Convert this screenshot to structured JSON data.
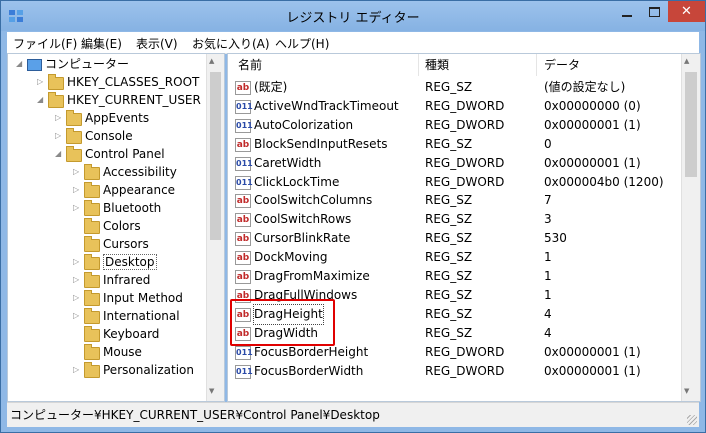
{
  "window": {
    "title": "レジストリ エディター"
  },
  "menu": [
    "ファイル(F)",
    "編集(E)",
    "表示(V)",
    "お気に入り(A)",
    "ヘルプ(H)"
  ],
  "tree": {
    "root": "コンピューター",
    "items": [
      {
        "label": "HKEY_CLASSES_ROOT",
        "level": 1,
        "arrow": "▷"
      },
      {
        "label": "HKEY_CURRENT_USER",
        "level": 1,
        "arrow": "◢"
      },
      {
        "label": "AppEvents",
        "level": 2,
        "arrow": "▷"
      },
      {
        "label": "Console",
        "level": 2,
        "arrow": "▷"
      },
      {
        "label": "Control Panel",
        "level": 2,
        "arrow": "◢"
      },
      {
        "label": "Accessibility",
        "level": 3,
        "arrow": "▷"
      },
      {
        "label": "Appearance",
        "level": 3,
        "arrow": "▷"
      },
      {
        "label": "Bluetooth",
        "level": 3,
        "arrow": "▷"
      },
      {
        "label": "Colors",
        "level": 3,
        "arrow": ""
      },
      {
        "label": "Cursors",
        "level": 3,
        "arrow": ""
      },
      {
        "label": "Desktop",
        "level": 3,
        "arrow": "▷",
        "selected": true
      },
      {
        "label": "Infrared",
        "level": 3,
        "arrow": "▷"
      },
      {
        "label": "Input Method",
        "level": 3,
        "arrow": "▷"
      },
      {
        "label": "International",
        "level": 3,
        "arrow": "▷"
      },
      {
        "label": "Keyboard",
        "level": 3,
        "arrow": ""
      },
      {
        "label": "Mouse",
        "level": 3,
        "arrow": ""
      },
      {
        "label": "Personalization",
        "level": 3,
        "arrow": "▷"
      }
    ]
  },
  "list": {
    "headers": {
      "name": "名前",
      "type": "種類",
      "data": "データ"
    },
    "rows": [
      {
        "icon": "ab",
        "name": "(既定)",
        "type": "REG_SZ",
        "data": "(値の設定なし)"
      },
      {
        "icon": "num",
        "name": "ActiveWndTrackTimeout",
        "type": "REG_DWORD",
        "data": "0x00000000 (0)"
      },
      {
        "icon": "num",
        "name": "AutoColorization",
        "type": "REG_DWORD",
        "data": "0x00000001 (1)"
      },
      {
        "icon": "ab",
        "name": "BlockSendInputResets",
        "type": "REG_SZ",
        "data": "0"
      },
      {
        "icon": "num",
        "name": "CaretWidth",
        "type": "REG_DWORD",
        "data": "0x00000001 (1)"
      },
      {
        "icon": "num",
        "name": "ClickLockTime",
        "type": "REG_DWORD",
        "data": "0x000004b0 (1200)"
      },
      {
        "icon": "ab",
        "name": "CoolSwitchColumns",
        "type": "REG_SZ",
        "data": "7"
      },
      {
        "icon": "ab",
        "name": "CoolSwitchRows",
        "type": "REG_SZ",
        "data": "3"
      },
      {
        "icon": "ab",
        "name": "CursorBlinkRate",
        "type": "REG_SZ",
        "data": "530"
      },
      {
        "icon": "ab",
        "name": "DockMoving",
        "type": "REG_SZ",
        "data": "1"
      },
      {
        "icon": "ab",
        "name": "DragFromMaximize",
        "type": "REG_SZ",
        "data": "1"
      },
      {
        "icon": "ab",
        "name": "DragFullWindows",
        "type": "REG_SZ",
        "data": "1"
      },
      {
        "icon": "ab",
        "name": "DragHeight",
        "type": "REG_SZ",
        "data": "4",
        "focused": true
      },
      {
        "icon": "ab",
        "name": "DragWidth",
        "type": "REG_SZ",
        "data": "4"
      },
      {
        "icon": "num",
        "name": "FocusBorderHeight",
        "type": "REG_DWORD",
        "data": "0x00000001 (1)"
      },
      {
        "icon": "num",
        "name": "FocusBorderWidth",
        "type": "REG_DWORD",
        "data": "0x00000001 (1)"
      }
    ]
  },
  "status": {
    "path": "コンピューター¥HKEY_CURRENT_USER¥Control Panel¥Desktop"
  },
  "colors": {
    "titlebar": "#8fb8e6",
    "close": "#c7463a",
    "highlight": "#e00000"
  }
}
